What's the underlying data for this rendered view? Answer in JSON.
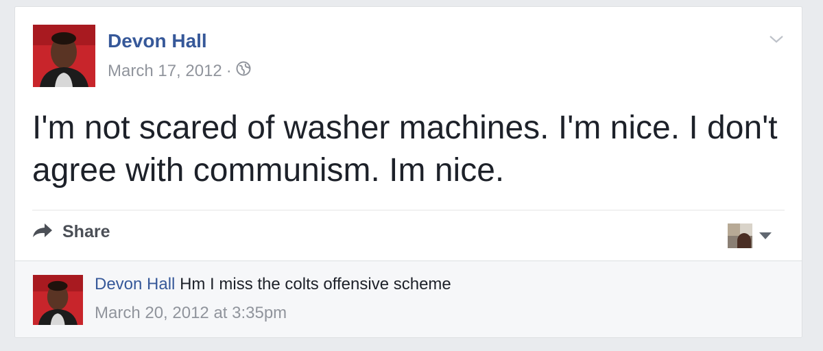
{
  "post": {
    "author": "Devon Hall",
    "date": "March 17, 2012",
    "separator": "·",
    "privacy_icon": "globe-icon",
    "menu_icon": "chevron-down-icon",
    "text": "I'm not scared of washer machines. I'm nice. I don't agree with communism. Im nice."
  },
  "actions": {
    "share_label": "Share",
    "share_icon": "share-arrow-icon"
  },
  "comment": {
    "author": "Devon Hall",
    "text": "Hm I miss the colts offensive scheme",
    "timestamp": "March 20, 2012 at 3:35pm"
  },
  "colors": {
    "link": "#365899",
    "meta": "#90949c",
    "text": "#1d2129",
    "background": "#e9ebee"
  }
}
